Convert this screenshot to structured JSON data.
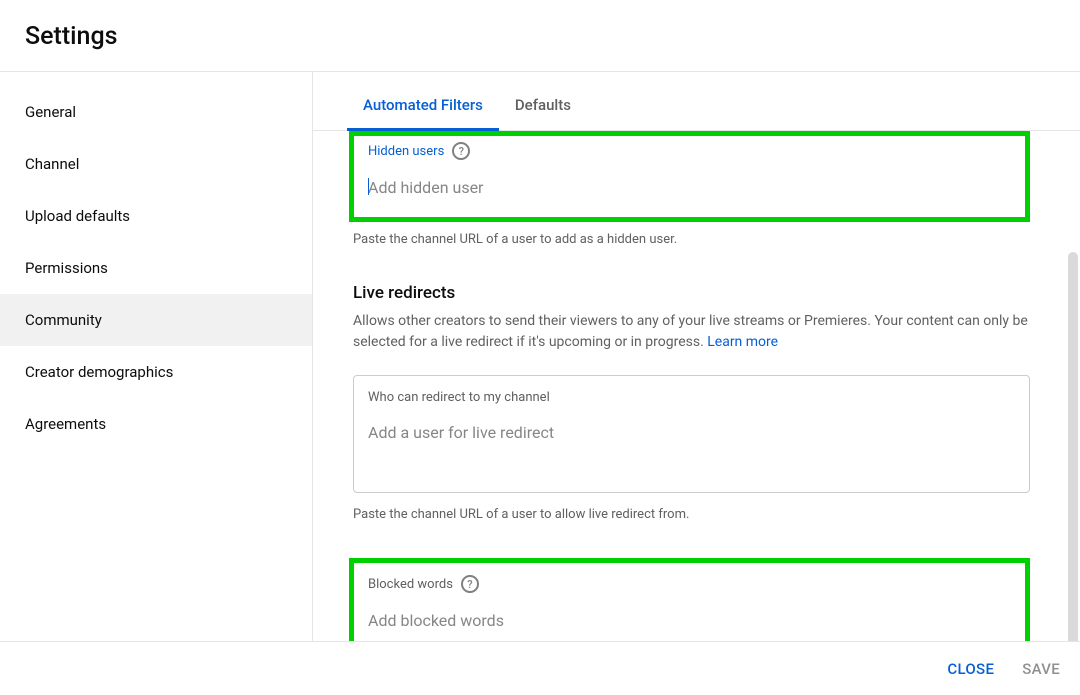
{
  "header": {
    "title": "Settings"
  },
  "sidebar": {
    "items": [
      {
        "label": "General"
      },
      {
        "label": "Channel"
      },
      {
        "label": "Upload defaults"
      },
      {
        "label": "Permissions"
      },
      {
        "label": "Community"
      },
      {
        "label": "Creator demographics"
      },
      {
        "label": "Agreements"
      }
    ]
  },
  "tabs": {
    "automated_filters": "Automated Filters",
    "defaults": "Defaults"
  },
  "hidden_users": {
    "label": "Hidden users",
    "placeholder": "Add hidden user",
    "helper": "Paste the channel URL of a user to add as a hidden user."
  },
  "live_redirects": {
    "title": "Live redirects",
    "description": "Allows other creators to send their viewers to any of your live streams or Premieres. Your content can only be selected for a live redirect if it's upcoming or in progress. ",
    "learn_more": "Learn more",
    "field_label": "Who can redirect to my channel",
    "placeholder": "Add a user for live redirect",
    "helper": "Paste the channel URL of a user to allow live redirect from."
  },
  "blocked_words": {
    "label": "Blocked words",
    "placeholder": "Add blocked words"
  },
  "footer": {
    "close": "CLOSE",
    "save": "SAVE"
  }
}
